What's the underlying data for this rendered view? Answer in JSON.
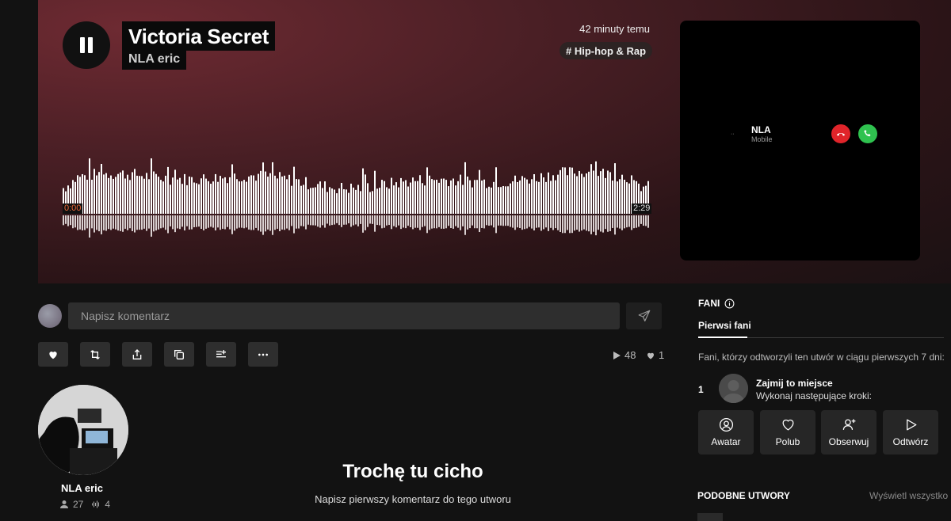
{
  "player": {
    "title": "Victoria Secret",
    "artist": "NLA eric",
    "time_ago": "42 minuty temu",
    "genre_tag": "# Hip-hop & Rap",
    "current_time": "0:00",
    "duration": "2:29",
    "progress": 0
  },
  "video": {
    "caller_name": "NLA",
    "caller_sub": "Mobile",
    "dots": "··"
  },
  "comment": {
    "placeholder": "Napisz komentarz"
  },
  "stats": {
    "plays": "48",
    "likes": "1"
  },
  "profile": {
    "name": "NLA eric",
    "followers": "27",
    "tracks": "4"
  },
  "empty_state": {
    "title": "Trochę tu cicho",
    "subtitle": "Napisz pierwszy komentarz do tego utworu"
  },
  "fans": {
    "heading": "FANI",
    "tab": "Pierwsi fani",
    "description": "Fani, którzy odtworzyli ten utwór w ciągu pierwszych 7 dni:",
    "rank": "1",
    "slot_title": "Zajmij to miejsce",
    "slot_sub": "Wykonaj następujące kroki:",
    "actions": [
      {
        "label": "Awatar",
        "icon": "avatar-icon"
      },
      {
        "label": "Polub",
        "icon": "heart-icon"
      },
      {
        "label": "Obserwuj",
        "icon": "follow-icon"
      },
      {
        "label": "Odtwórz",
        "icon": "play-icon"
      }
    ]
  },
  "similar": {
    "heading": "PODOBNE UTWORY",
    "show_all": "Wyświetl wszystko"
  },
  "colors": {
    "progress_accent": "#f06a3c",
    "decline": "#e0242a",
    "accept": "#2fc24f"
  }
}
